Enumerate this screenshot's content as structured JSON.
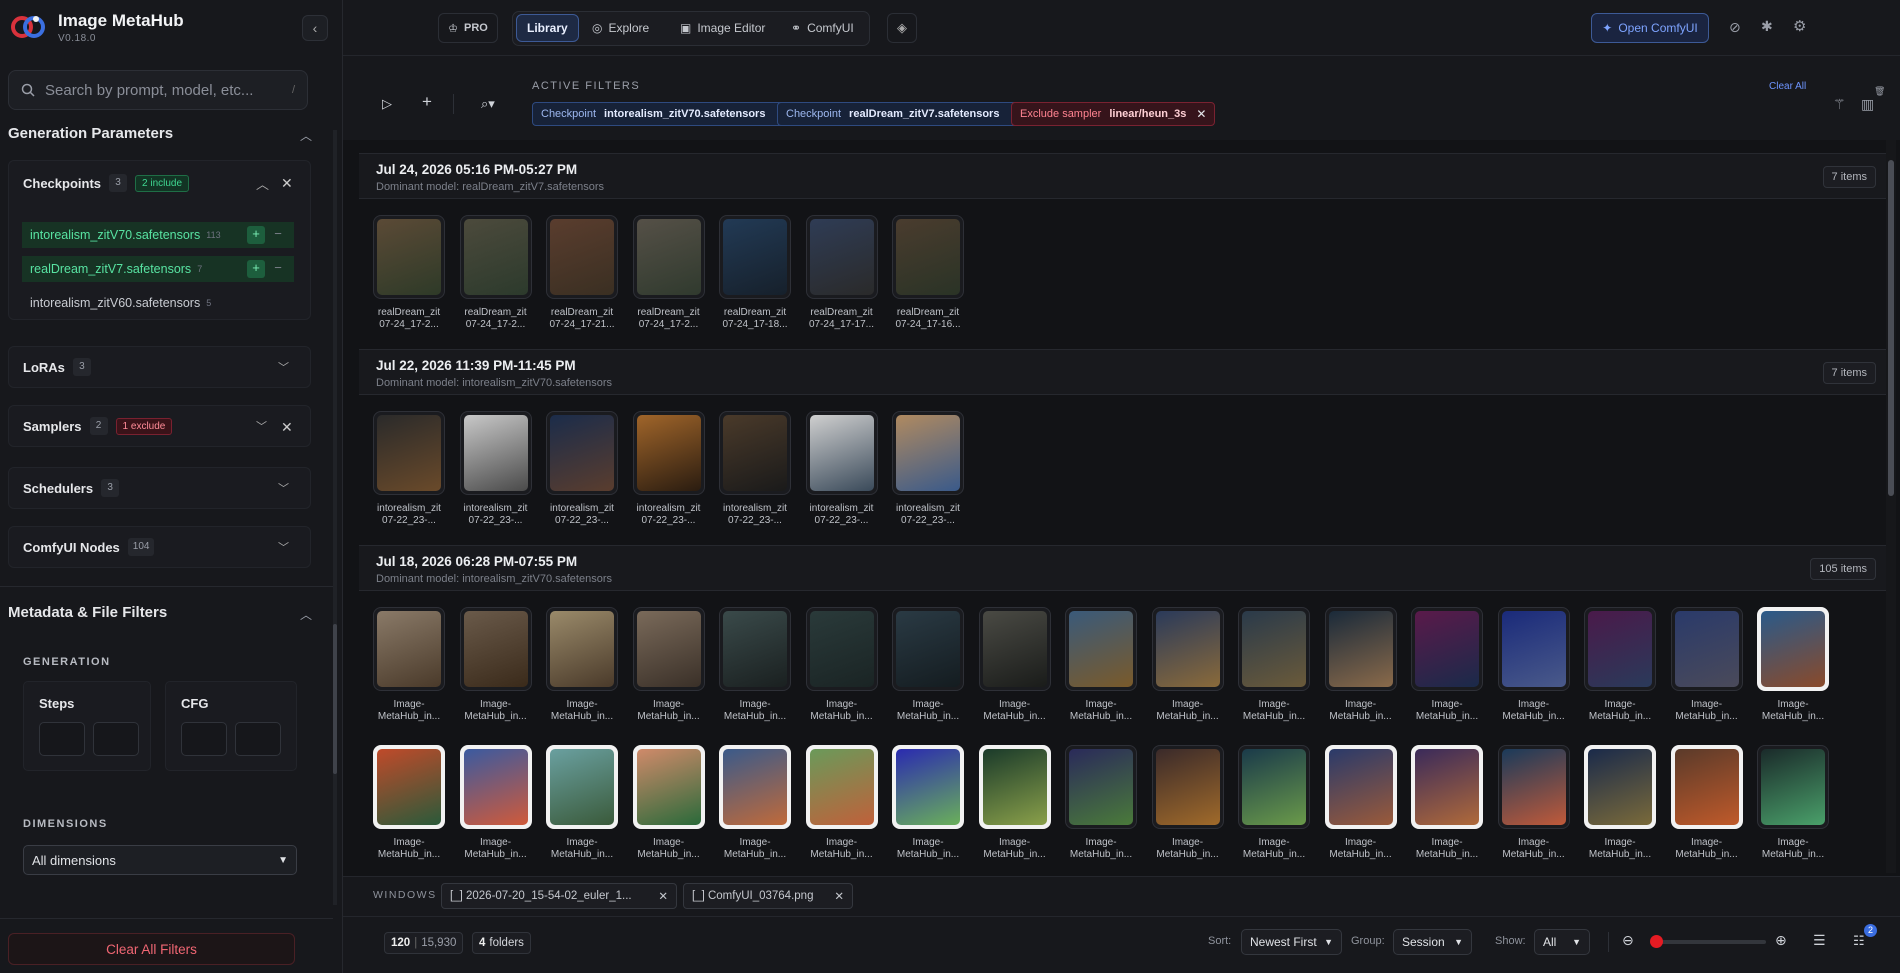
{
  "app": {
    "title": "Image MetaHub",
    "version": "V0.18.0"
  },
  "sidebar": {
    "search_placeholder": "Search by prompt, model, etc...",
    "search_kbd": "/",
    "section_generation": "Generation Parameters",
    "checkpoints": {
      "label": "Checkpoints",
      "count": "3",
      "badge": "2 include",
      "items": [
        {
          "label": "intorealism_zitV70.safetensors",
          "n": "113",
          "state": "include"
        },
        {
          "label": "realDream_zitV7.safetensors",
          "n": "7",
          "state": "include"
        },
        {
          "label": "intorealism_zitV60.safetensors",
          "n": "5",
          "state": "none"
        }
      ]
    },
    "loras": {
      "label": "LoRAs",
      "count": "3"
    },
    "samplers": {
      "label": "Samplers",
      "count": "2",
      "badge": "1 exclude"
    },
    "schedulers": {
      "label": "Schedulers",
      "count": "3"
    },
    "nodes": {
      "label": "ComfyUI Nodes",
      "count": "104"
    },
    "section_metadata": "Metadata & File Filters",
    "generation_label": "GENERATION",
    "steps_label": "Steps",
    "cfg_label": "CFG",
    "dimensions_label": "DIMENSIONS",
    "dimensions_value": "All dimensions",
    "clear_all": "Clear All Filters"
  },
  "topbar": {
    "pro": "PRO",
    "tabs": [
      "Library",
      "Explore",
      "Image Editor",
      "ComfyUI"
    ],
    "open_comfy": "Open ComfyUI"
  },
  "filters": {
    "label": "ACTIVE FILTERS",
    "clear_all": "Clear All",
    "chips": [
      {
        "key": "Checkpoint",
        "value": "intorealism_zitV70.safetensors",
        "type": "include"
      },
      {
        "key": "Checkpoint",
        "value": "realDream_zitV7.safetensors",
        "type": "include"
      },
      {
        "key": "Exclude sampler",
        "value": "linear/heun_3s",
        "type": "exclude"
      }
    ]
  },
  "groups": [
    {
      "title": "Jul 24, 2026 05:16 PM-05:27 PM",
      "sub": "Dominant model: realDream_zitV7.safetensors",
      "count": "7 items",
      "items": [
        [
          "realDream_zit",
          "07-24_17-2..."
        ],
        [
          "realDream_zit",
          "07-24_17-2..."
        ],
        [
          "realDream_zit",
          "07-24_17-21..."
        ],
        [
          "realDream_zit",
          "07-24_17-2..."
        ],
        [
          "realDream_zit",
          "07-24_17-18..."
        ],
        [
          "realDream_zit",
          "07-24_17-17..."
        ],
        [
          "realDream_zit",
          "07-24_17-16..."
        ]
      ]
    },
    {
      "title": "Jul 22, 2026 11:39 PM-11:45 PM",
      "sub": "Dominant model: intorealism_zitV70.safetensors",
      "count": "7 items",
      "items": [
        [
          "intorealism_zit",
          "07-22_23-..."
        ],
        [
          "intorealism_zit",
          "07-22_23-..."
        ],
        [
          "intorealism_zit",
          "07-22_23-..."
        ],
        [
          "intorealism_zit",
          "07-22_23-..."
        ],
        [
          "intorealism_zit",
          "07-22_23-..."
        ],
        [
          "intorealism_zit",
          "07-22_23-..."
        ],
        [
          "intorealism_zit",
          "07-22_23-..."
        ]
      ]
    },
    {
      "title": "Jul 18, 2026 06:28 PM-07:55 PM",
      "sub": "Dominant model: intorealism_zitV70.safetensors",
      "count": "105 items",
      "cap1": "Image-",
      "cap2": "MetaHub_in..."
    }
  ],
  "windows": {
    "label": "WINDOWS",
    "items": [
      "[_] 2026-07-20_15-54-02_euler_1...",
      "[_] ComfyUI_03764.png"
    ]
  },
  "footer": {
    "shown": "120",
    "total": "15,930",
    "folders_n": "4",
    "folders_label": "folders",
    "sort_label": "Sort:",
    "sort_value": "Newest First",
    "group_label": "Group:",
    "group_value": "Session",
    "show_label": "Show:",
    "show_value": "All",
    "zoom_fraction": 0.0,
    "queue_badge": "2"
  }
}
